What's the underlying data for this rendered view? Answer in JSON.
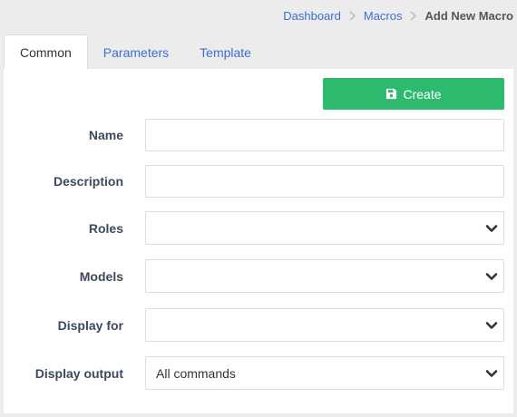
{
  "breadcrumb": {
    "items": [
      "Dashboard",
      "Macros"
    ],
    "current": "Add New Macro"
  },
  "tabs": [
    "Common",
    "Parameters",
    "Template"
  ],
  "actions": {
    "create_label": "Create"
  },
  "form": {
    "name_label": "Name",
    "name_value": "",
    "description_label": "Description",
    "description_value": "",
    "roles_label": "Roles",
    "roles_value": "",
    "models_label": "Models",
    "models_value": "",
    "display_for_label": "Display for",
    "display_for_value": "",
    "display_output_label": "Display output",
    "display_output_value": "All commands"
  },
  "colors": {
    "accent": "#2dba6f",
    "link": "#3a6fd0",
    "label": "#3b4a5c"
  },
  "icons": {
    "create": "save-icon",
    "select": "chevron-down-icon",
    "breadcrumb_separator": "chevron-right-icon"
  }
}
